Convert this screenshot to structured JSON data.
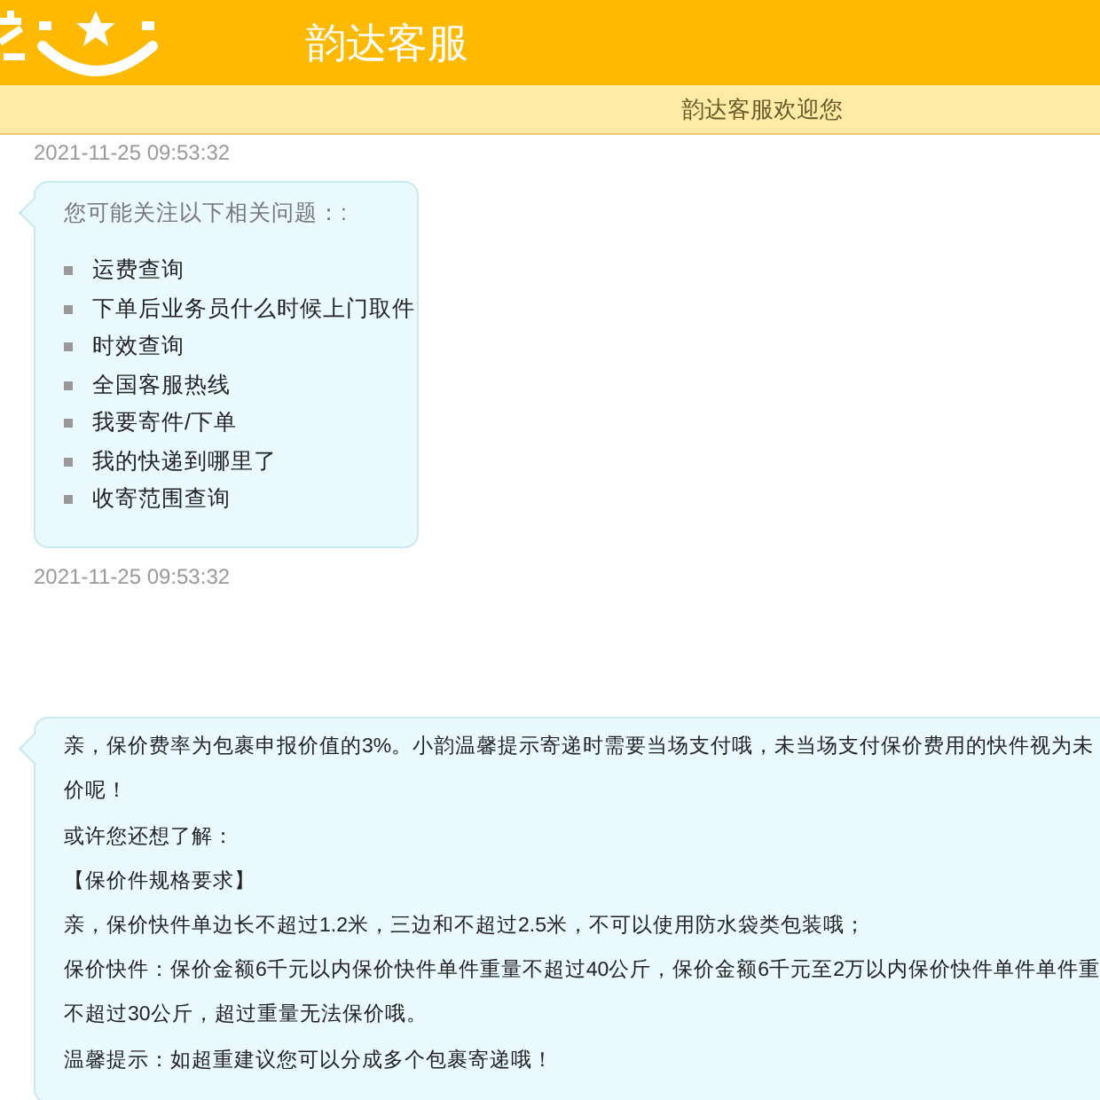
{
  "header": {
    "title": "韵达客服"
  },
  "welcome_bar": {
    "text": "韵达客服欢迎您"
  },
  "messages": [
    {
      "kind": "timestamp",
      "time": "2021-11-25 09:53:32"
    },
    {
      "kind": "list",
      "title": "您可能关注以下相关问题：:",
      "items": [
        "运费查询",
        "下单后业务员什么时候上门取件",
        "时效查询",
        "全国客服热线",
        "我要寄件/下单",
        "我的快递到哪里了",
        "收寄范围查询"
      ]
    },
    {
      "kind": "timestamp",
      "time": "2021-11-25 09:53:32"
    },
    {
      "kind": "text",
      "lines": [
        "亲，保价费率为包裹申报价值的3%。小韵温馨提示寄递时需要当场支付哦，未当场支付保价费用的快件视为未",
        "价呢！",
        "或许您还想了解：",
        "【保价件规格要求】",
        "亲，保价快件单边长不超过1.2米，三边和不超过2.5米，不可以使用防水袋类包装哦；",
        "保价快件：保价金额6千元以内保价快件单件重量不超过40公斤，保价金额6千元至2万以内保价快件单件单件重",
        "不超过30公斤，超过重量无法保价哦。",
        "温馨提示：如超重建议您可以分成多个包裹寄递哦！"
      ]
    }
  ]
}
